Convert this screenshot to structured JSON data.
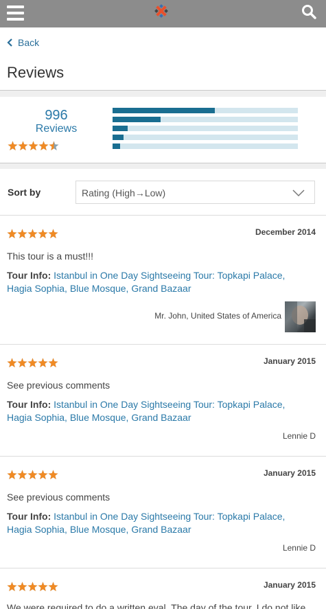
{
  "header": {
    "menu_icon": "hamburger-menu-icon",
    "logo_icon": "site-logo",
    "search_icon": "search-icon",
    "background": "#8c8c8c"
  },
  "nav": {
    "back_label": "Back"
  },
  "page": {
    "title": "Reviews"
  },
  "summary": {
    "count": "996",
    "label": "Reviews",
    "rating": 4.5,
    "distribution": [
      0.55,
      0.26,
      0.08,
      0.06,
      0.04
    ]
  },
  "sort": {
    "label": "Sort by",
    "selected": "Rating (High→Low)"
  },
  "reviews": [
    {
      "stars": 5,
      "date": "December 2014",
      "text": "This tour is a must!!!",
      "tour_label": "Tour Info:",
      "tour_link": "Istanbul in One Day Sightseeing Tour: Topkapi Palace, Hagia Sophia, Blue Mosque, Grand Bazaar",
      "author": "Mr. John, United States of America",
      "has_avatar": true
    },
    {
      "stars": 5,
      "date": "January 2015",
      "text": "See previous comments",
      "tour_label": "Tour Info:",
      "tour_link": "Istanbul in One Day Sightseeing Tour: Topkapi Palace, Hagia Sophia, Blue Mosque, Grand Bazaar",
      "author": "Lennie D",
      "has_avatar": false
    },
    {
      "stars": 5,
      "date": "January 2015",
      "text": "See previous comments",
      "tour_label": "Tour Info:",
      "tour_link": "Istanbul in One Day Sightseeing Tour: Topkapi Palace, Hagia Sophia, Blue Mosque, Grand Bazaar",
      "author": "Lennie D",
      "has_avatar": false
    },
    {
      "stars": 5,
      "date": "January 2015",
      "text": "We were required to do a written eval. The day of the tour, I do not like"
    }
  ],
  "colors": {
    "star": "#f08a24",
    "link": "#2a79a8",
    "bar_fill": "#1a6e91",
    "bar_track": "#d3e6ee"
  }
}
